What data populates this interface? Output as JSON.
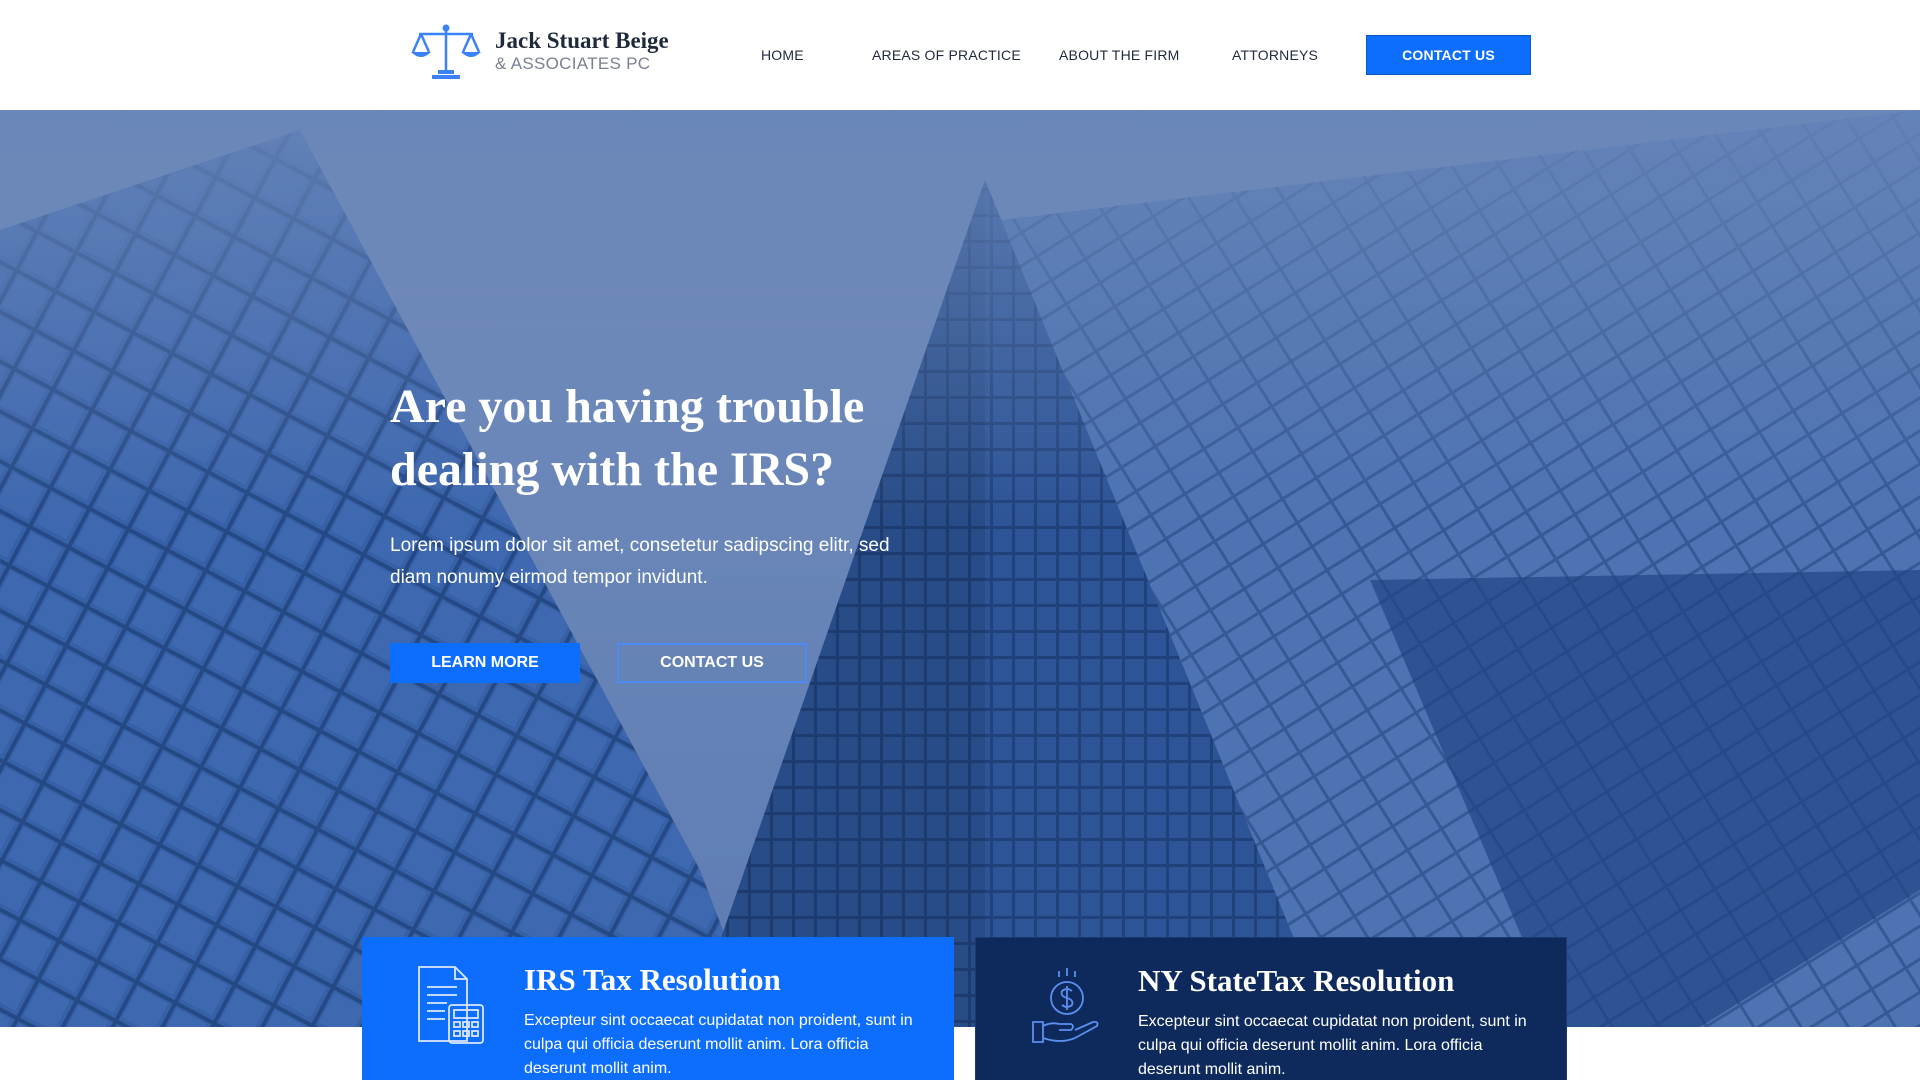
{
  "brand": {
    "name": "Jack Stuart Beige",
    "subtitle": "& ASSOCIATES PC",
    "icon": "scales-of-justice-icon",
    "accent_color": "#0d6efd",
    "navy_color": "#0e2a5c"
  },
  "nav": {
    "items": [
      {
        "label": "HOME"
      },
      {
        "label": "AREAS OF PRACTICE"
      },
      {
        "label": "ABOUT THE FIRM"
      },
      {
        "label": "ATTORNEYS"
      }
    ],
    "cta_label": "CONTACT US"
  },
  "hero": {
    "title": "Are you having trouble dealing with the IRS?",
    "text": "Lorem ipsum dolor sit amet, consetetur sadipscing elitr, sed diam nonumy eirmod tempor invidunt.",
    "primary_button": "LEARN MORE",
    "secondary_button": "CONTACT US"
  },
  "cards": [
    {
      "title": "IRS Tax Resolution",
      "text": "Excepteur sint occaecat cupidatat non proident, sunt in culpa qui officia deserunt mollit anim. Lora officia deserunt mollit anim.",
      "icon": "tax-document-calculator-icon"
    },
    {
      "title": "NY StateTax Resolution",
      "text": "Excepteur sint occaecat cupidatat non proident, sunt in culpa qui officia deserunt mollit anim. Lora officia deserunt mollit anim.",
      "icon": "hand-dollar-coin-icon"
    }
  ]
}
